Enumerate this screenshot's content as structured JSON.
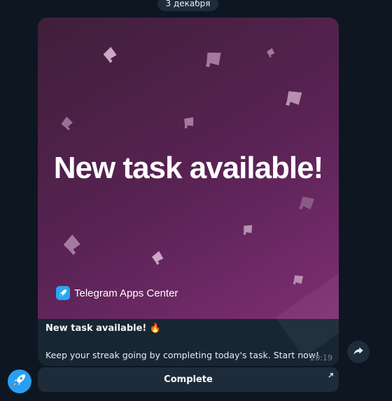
{
  "date_separator": "3 декабря",
  "message": {
    "banner_headline": "New task available!",
    "brand_name": "Telegram Apps Center",
    "caption_title": "New task available! 🔥",
    "caption_body": "Keep your streak going by completing today's task. Start now!",
    "time": "20:19"
  },
  "button": {
    "label": "Complete"
  },
  "icons": {
    "megaphone": "megaphone-icon",
    "share": "share-icon",
    "external": "external-link-icon",
    "avatar": "rocket-icon"
  },
  "colors": {
    "background": "#0e1621",
    "bubble": "#182533",
    "banner_start": "#3f1f3a",
    "banner_end": "#7e2e73",
    "brand_accent": "#2aa6f1"
  }
}
